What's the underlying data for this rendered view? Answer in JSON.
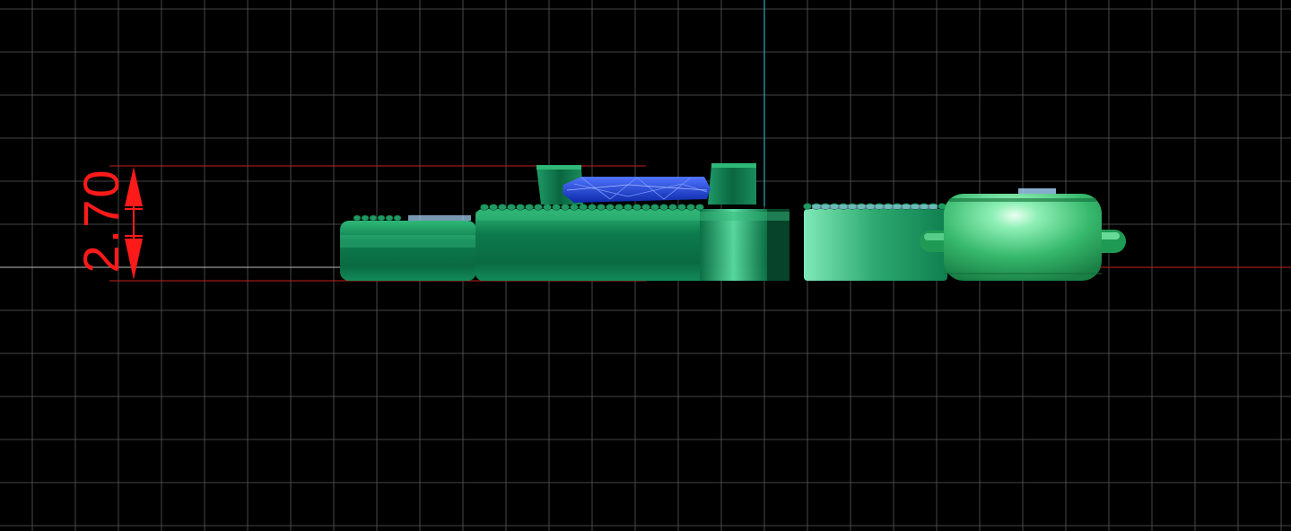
{
  "viewport": {
    "background_color": "#000000",
    "grid_color": "#5a5a5a",
    "axis_color": "#bdbdbd",
    "vertical_axis_color": "#2fa7b8"
  },
  "dimension": {
    "value_label": "2.70",
    "color": "#ff1a1a",
    "arrow_icon": "double-headed-vertical-arrow"
  },
  "model": {
    "metal_color": "#0f8a55",
    "metal_highlight": "#7be8b5",
    "stone_color": "#1a3fd6",
    "stone_highlight": "#6f8cff",
    "crystal_color": "#a9d8ff"
  }
}
